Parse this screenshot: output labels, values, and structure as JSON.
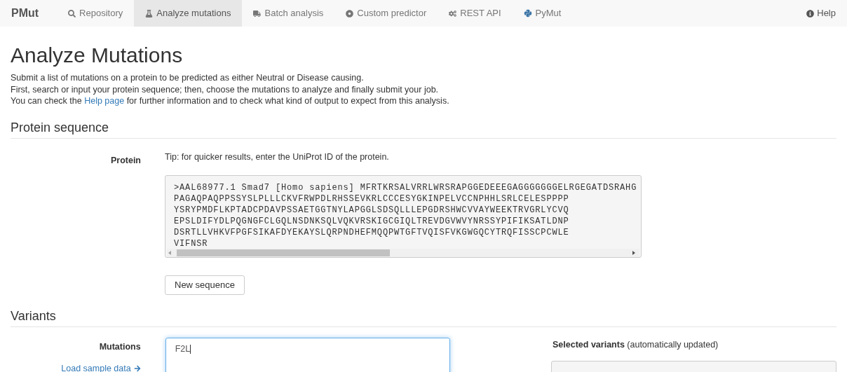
{
  "navbar": {
    "brand": "PMut",
    "items": [
      {
        "label": "Repository",
        "selected": false
      },
      {
        "label": "Analyze mutations",
        "selected": true
      },
      {
        "label": "Batch analysis",
        "selected": false
      },
      {
        "label": "Custom predictor",
        "selected": false
      },
      {
        "label": "REST API",
        "selected": false
      },
      {
        "label": "PyMut",
        "selected": false
      }
    ],
    "help": {
      "label": "Help"
    }
  },
  "title": "Analyze Mutations",
  "intro": [
    {
      "text": "Submit a list of mutations on a protein to be predicted as either Neutral or Disease causing."
    },
    {
      "text": "First, search or input your protein sequence; then, choose the mutations to analyze and finally submit your job."
    },
    {
      "before": "You can check the ",
      "link": "Help page",
      "after": " for further information and to check what kind of output to expect from this analysis."
    }
  ],
  "protein_section": {
    "heading": "Protein sequence",
    "label": "Protein",
    "tip": "Tip: for quicker results, enter the UniProt ID of the protein.",
    "sequence_lines": [
      ">AAL68977.1 Smad7 [Homo sapiens] MFRTKRSALVRRLWRSRAPGGEDEEEGAGGGGGGGELRGEGATDSRAHG",
      "PAGAQPAQPPSSYSLPLLLCKVFRWPDLRHSSEVKRLCCCESYGKINPELVCCNPHHLSRLCELESPPPP",
      "YSRYPMDFLKPTADCPDAVPSSAETGGTNYLAPGGLSDSQLLLEPGDRSHWCVVAYWEEKTRVGRLYCVQ",
      "EPSLDIFYDLPQGNGFCLGQLNSDNKSQLVQKVRSKIGCGIQLTREVDGVWVYNRSSYPIFIKSATLDNP",
      "DSRTLLVHKVFPGFSIKAFDYEKAYSLQRPNDHEFMQQPWTGFTVQISFVKGWGQCYTRQFISSCPCWLE",
      "VIFNSR"
    ],
    "button": "New sequence"
  },
  "variants_section": {
    "heading": "Variants",
    "label": "Mutations",
    "mutations_value": "F2L",
    "sample_link": "Load sample data",
    "selected_title": "Selected variants",
    "selected_note": "(automatically updated)"
  }
}
